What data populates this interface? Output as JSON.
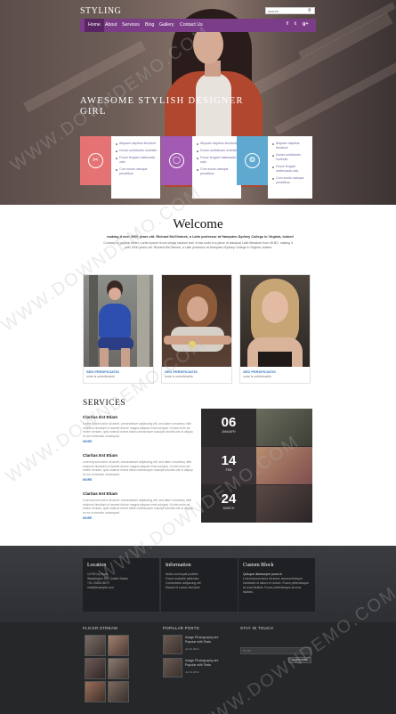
{
  "header": {
    "logo": "STYLING",
    "search_placeholder": "search",
    "nav": [
      "Home",
      "About",
      "Services",
      "Blog",
      "Gallery",
      "Contact Us"
    ],
    "social": [
      "f",
      "t",
      "g+"
    ]
  },
  "hero": {
    "title": "AWESOME STYLISH DESIGNER GIRL",
    "features": [
      {
        "icon": "scissors-icon",
        "color": "#e57373",
        "items": [
          "Aliquam dapibus tincidunt",
          "Donec sollicitudin molestie",
          "Fusce feugiat malesuada odio",
          "Cum sociis natoque penatibus"
        ]
      },
      {
        "icon": "bracelet-icon",
        "color": "#a35ab3",
        "items": [
          "Aliquam dapibus tincidunt",
          "Donec sollicitudin molestie",
          "Fusce feugiat malesuada odio",
          "Cum sociis natoque penatibus"
        ]
      },
      {
        "icon": "yarn-icon",
        "color": "#5fa9d1",
        "items": [
          "Aliquam dapibus tincidunt",
          "Donec sollicitudin molestie",
          "Fusce feugiat malesuada odio",
          "Cum sociis natoque penatibus"
        ]
      }
    ]
  },
  "welcome": {
    "title": "Welcome",
    "lead": "making it over 2000 years old. Richard McClintock, a Latin professor at Hampden-Sydney College in Virginia, looked",
    "body": "Contrary to popular belief, Lorem Ipsum is not simply random text. It has roots in a piece of classical Latin literature from 45 BC, making it over 2000 years old. Richard McClintock, a Latin professor at Hampden-Sydney College in Virginia, looked"
  },
  "cards": [
    {
      "title": "SED PERSPICIATIS",
      "sub": "unde is unbelievable"
    },
    {
      "title": "SED PERSPICIATIS",
      "sub": "unde is unbelievable"
    },
    {
      "title": "SED PERSPICIATIS",
      "sub": "unde is unbelievable"
    }
  ],
  "services": {
    "title": "SERVICES",
    "items": [
      {
        "title": "Claritas Est Etiam",
        "text": "Lorem ipsum dolor sit amet, consectetuer adipiscing elit, sed diam nonummy nibh euismod tincidunt ut laoreet dolore magna aliquam erat volutpat. Ut wisi enim ad minim veniam, quis nostrud exerci tation ullamcorper suscipit lobortis nisl ut aliquip ex ea commodo consequat.",
        "more": "MORE"
      },
      {
        "title": "Claritas Est Etiam",
        "text": "Lorem ipsum dolor sit amet, consectetuer adipiscing elit, sed diam nonummy nibh euismod tincidunt ut laoreet dolore magna aliquam erat volutpat. Ut wisi enim ad minim veniam, quis nostrud exerci tation ullamcorper suscipit lobortis nisl ut aliquip ex ea commodo consequat.",
        "more": "MORE"
      },
      {
        "title": "Claritas Est Etiam",
        "text": "Lorem ipsum dolor sit amet, consectetuer adipiscing elit, sed diam nonummy nibh euismod tincidunt ut laoreet dolore magna aliquam erat volutpat. Ut wisi enim ad minim veniam, quis nostrud exerci tation ullamcorper suscipit lobortis nisl ut aliquip ex ea commodo consequat.",
        "more": "MORE"
      }
    ],
    "dates": [
      {
        "day": "06",
        "month": "JANUARY"
      },
      {
        "day": "14",
        "month": "FEB"
      },
      {
        "day": "24",
        "month": "MARCH"
      }
    ]
  },
  "footer": {
    "location": {
      "title": "Location",
      "lines": [
        "14799 nq Road",
        "Washington DC, United States",
        "+01 23456 8679",
        "mail@example.com"
      ]
    },
    "information": {
      "title": "Information",
      "lines": [
        "Nulla consequat porttitor",
        "Fusce molestie pellentes",
        "Consectetur adipiscing elit",
        "Mauris et cursus tincidunt"
      ]
    },
    "custom": {
      "title": "Custom Block",
      "lead": "Quisque ullamcorper purus in",
      "text": "Lorem ipsum dolor sit amet, eiusmod tempor incididunt ut labore et dolore. Fusce pellentesque at urna facilisis. Fusce pellentesque at urna facilisis."
    },
    "flickr_label": "FLICKR STREAM",
    "popular_label": "POPULAR POSTS",
    "stay_label": "STAY IN TOUCH",
    "posts": [
      {
        "title": "Image Photography are Popular with Tests",
        "date": "Jul 19 2014"
      },
      {
        "title": "Image Photography are Popular with Tests",
        "date": "Jul 19 2014"
      }
    ],
    "subscribe_placeholder": "Email",
    "subscribe_button": "SUBSCRIBE"
  },
  "watermark": "WWW.DOWNDEMO.COM"
}
